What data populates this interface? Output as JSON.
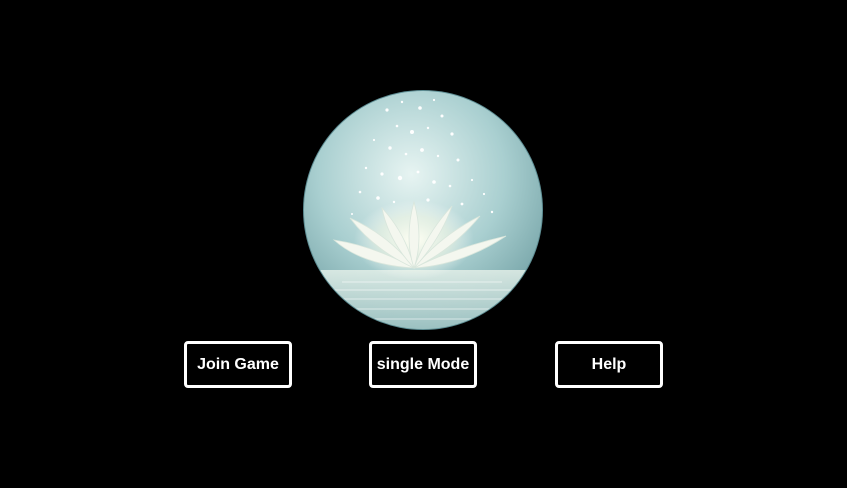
{
  "menu": {
    "join_label": "Join Game",
    "single_label": "single Mode",
    "help_label": "Help"
  },
  "logo": {
    "icon": "lotus-orb-icon",
    "colors": {
      "orb_light": "#cfe7e6",
      "orb_dark": "#6f9ea2",
      "petal": "#f4f7ef"
    }
  },
  "colors": {
    "background": "#000000",
    "button_border": "#ffffff",
    "button_text": "#ffffff"
  }
}
